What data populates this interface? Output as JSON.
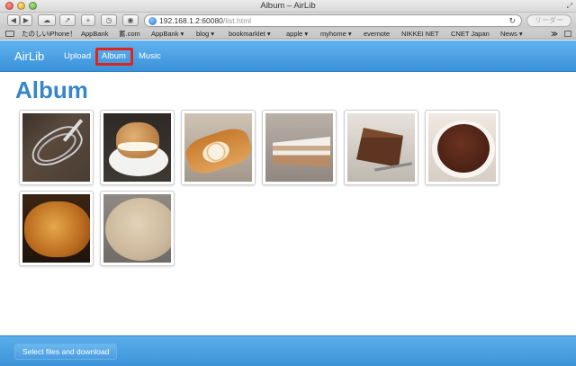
{
  "window": {
    "title": "Album – AirLib"
  },
  "browser": {
    "address": "192.168.1.2:60080",
    "address_path": "/list.html",
    "reader_label": "リーダー",
    "bookmarks": [
      "たのしいiPhone！",
      "AppBank",
      "蓄.com",
      "AppBank ▾",
      "blog ▾",
      "bookmarklet ▾",
      "apple ▾",
      "myhome ▾",
      "evernote",
      "NIKKEI NET",
      "CNET Japan",
      "News ▾"
    ],
    "bookmarks_more": "≫"
  },
  "navbar": {
    "brand": "AirLib",
    "links": [
      {
        "label": "Upload"
      },
      {
        "label": "Album"
      },
      {
        "label": "Music"
      }
    ],
    "highlight_color": "#e0261c"
  },
  "main": {
    "title": "Album",
    "thumbnails": [
      "whisk",
      "cream-puff",
      "roll-cake",
      "layer-cake",
      "chocolate-cake-slice",
      "chocolate-cake",
      "custard-tart",
      "pudding"
    ]
  },
  "footer": {
    "button_label": "Select files and download"
  },
  "colors": {
    "navbar": "#4aa3e4",
    "title": "#3786c7",
    "footer": "#4aa0e2"
  }
}
